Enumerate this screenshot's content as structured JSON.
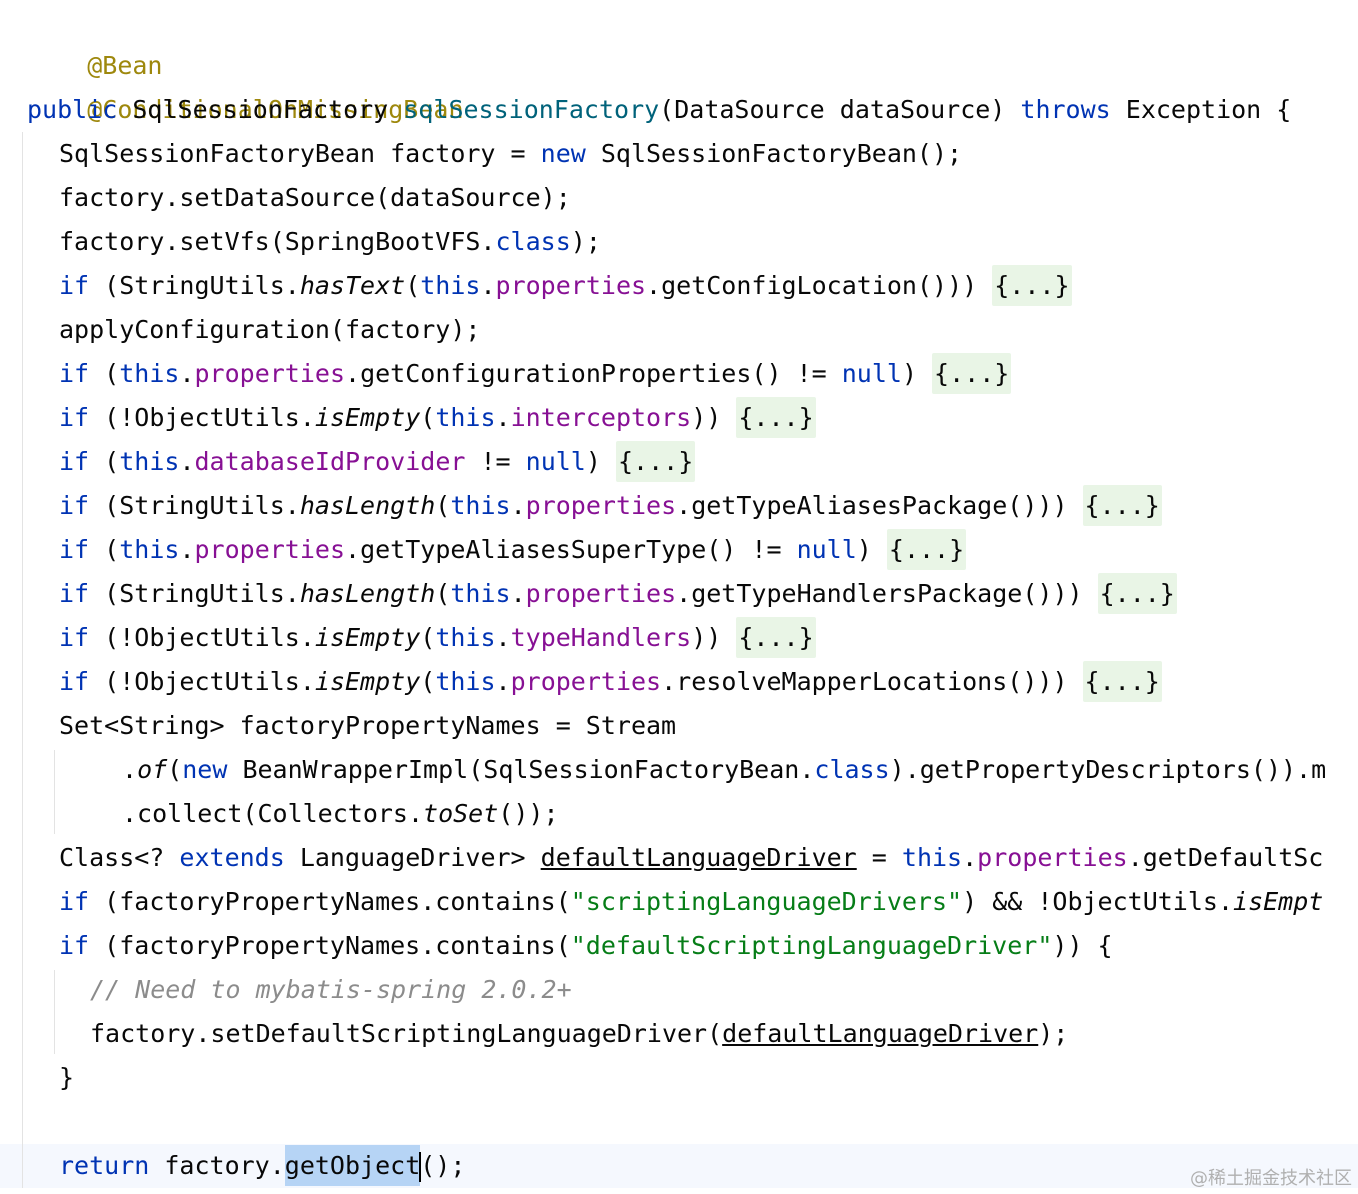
{
  "editor": {
    "theme": {
      "keyword": "#0033b3",
      "annotation": "#9e880d",
      "field": "#871094",
      "string": "#067d17",
      "comment": "#8c8c8c",
      "method_declaration": "#00627a",
      "folded_region": "#e9f5e6",
      "usage_highlight": "#b6d4f5",
      "current_line": "#f5f8fe"
    },
    "l1": {
      "annotation": "@Bean"
    },
    "l2": {
      "annotation": "@ConditionalOnMissingBean"
    },
    "l3": {
      "kw_public": "public",
      "sp1": " SqlSessionFactory ",
      "method": "sqlSessionFactory",
      "params": "(DataSource dataSource) ",
      "kw_throws": "throws",
      "tail": " Exception {"
    },
    "l4": {
      "a": "SqlSessionFactoryBean factory = ",
      "kw_new": "new",
      "b": " SqlSessionFactoryBean();"
    },
    "l5": {
      "a": "factory.setDataSource(dataSource);"
    },
    "l6": {
      "a": "factory.setVfs(SpringBootVFS.",
      "kw_class": "class",
      "b": ");"
    },
    "l7": {
      "kw_if": "if",
      "a": " (StringUtils.",
      "static_m": "hasText",
      "b": "(",
      "kw_this": "this",
      "c": ".",
      "field": "properties",
      "d": ".getConfigLocation())) ",
      "fold": "{...}"
    },
    "l8": {
      "a": "applyConfiguration(factory);"
    },
    "l9": {
      "kw_if": "if",
      "a": " (",
      "kw_this": "this",
      "b": ".",
      "field": "properties",
      "c": ".getConfigurationProperties() != ",
      "kw_null": "null",
      "d": ") ",
      "fold": "{...}"
    },
    "l10": {
      "kw_if": "if",
      "a": " (!ObjectUtils.",
      "static_m": "isEmpty",
      "b": "(",
      "kw_this": "this",
      "c": ".",
      "field": "interceptors",
      "d": ")) ",
      "fold": "{...}"
    },
    "l11": {
      "kw_if": "if",
      "a": " (",
      "kw_this": "this",
      "b": ".",
      "field": "databaseIdProvider",
      "c": " != ",
      "kw_null": "null",
      "d": ") ",
      "fold": "{...}"
    },
    "l12": {
      "kw_if": "if",
      "a": " (StringUtils.",
      "static_m": "hasLength",
      "b": "(",
      "kw_this": "this",
      "c": ".",
      "field": "properties",
      "d": ".getTypeAliasesPackage())) ",
      "fold": "{...}"
    },
    "l13": {
      "kw_if": "if",
      "a": " (",
      "kw_this": "this",
      "b": ".",
      "field": "properties",
      "c": ".getTypeAliasesSuperType() != ",
      "kw_null": "null",
      "d": ") ",
      "fold": "{...}"
    },
    "l14": {
      "kw_if": "if",
      "a": " (StringUtils.",
      "static_m": "hasLength",
      "b": "(",
      "kw_this": "this",
      "c": ".",
      "field": "properties",
      "d": ".getTypeHandlersPackage())) ",
      "fold": "{...}"
    },
    "l15": {
      "kw_if": "if",
      "a": " (!ObjectUtils.",
      "static_m": "isEmpty",
      "b": "(",
      "kw_this": "this",
      "c": ".",
      "field": "typeHandlers",
      "d": ")) ",
      "fold": "{...}"
    },
    "l16": {
      "kw_if": "if",
      "a": " (!ObjectUtils.",
      "static_m": "isEmpty",
      "b": "(",
      "kw_this": "this",
      "c": ".",
      "field": "properties",
      "d": ".resolveMapperLocations())) ",
      "fold": "{...}"
    },
    "l17": {
      "a": "Set<String> factoryPropertyNames = Stream"
    },
    "l18": {
      "a": ".",
      "static_m": "of",
      "b": "(",
      "kw_new": "new",
      "c": " BeanWrapperImpl(SqlSessionFactoryBean.",
      "kw_class": "class",
      "d": ").getPropertyDescriptors()).m"
    },
    "l19": {
      "a": ".collect(Collectors.",
      "static_m": "toSet",
      "b": "());"
    },
    "l20": {
      "a": "Class<? ",
      "kw_extends": "extends",
      "b": " LanguageDriver> ",
      "var": "defaultLanguageDriver",
      "c": " = ",
      "kw_this": "this",
      "d": ".",
      "field": "properties",
      "e": ".getDefaultSc"
    },
    "l21": {
      "kw_if": "if",
      "a": " (factoryPropertyNames.contains(",
      "str": "\"scriptingLanguageDrivers\"",
      "b": ") && !ObjectUtils.",
      "static_m": "isEmpt"
    },
    "l22": {
      "kw_if": "if",
      "a": " (factoryPropertyNames.contains(",
      "str": "\"defaultScriptingLanguageDriver\"",
      "b": ")) {"
    },
    "l23": {
      "comment": "// Need to mybatis-spring 2.0.2+"
    },
    "l24": {
      "a": "factory.setDefaultScriptingLanguageDriver(",
      "var": "defaultLanguageDriver",
      "b": ");"
    },
    "l25": {
      "a": "}"
    },
    "l26": {
      "kw_return": "return",
      "a": " factory.",
      "hl": "getObject",
      "b": "();"
    }
  },
  "watermark": "@稀土掘金技术社区"
}
